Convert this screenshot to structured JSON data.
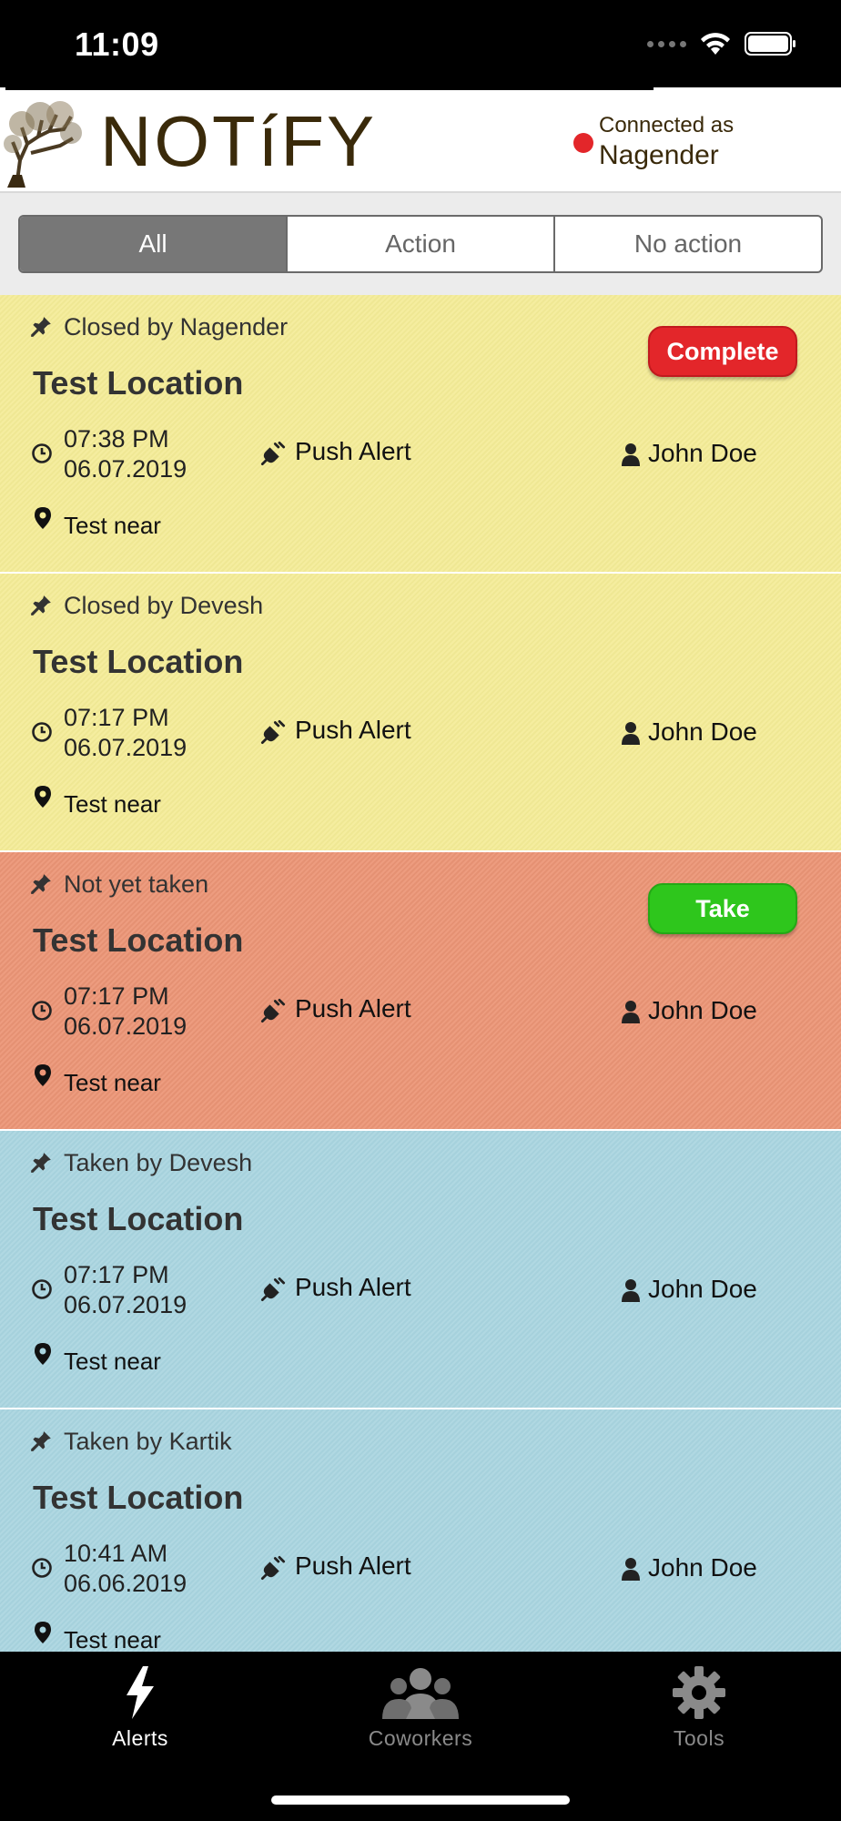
{
  "status_bar": {
    "time": "11:09"
  },
  "header": {
    "logo_text": "NOTíFY",
    "connected_label": "Connected as",
    "connected_user": "Nagender",
    "connection_status_color": "#e3262a"
  },
  "filter": {
    "tabs": [
      {
        "label": "All",
        "active": true
      },
      {
        "label": "Action",
        "active": false
      },
      {
        "label": "No action",
        "active": false
      }
    ]
  },
  "alerts": [
    {
      "status": "Closed by Nagender",
      "title": "Test Location",
      "time": "07:38 PM",
      "date": "06.07.2019",
      "type": "Push Alert",
      "assignee": "John Doe",
      "near": "Test near",
      "color": "yellow",
      "action": "Complete"
    },
    {
      "status": "Closed by Devesh",
      "title": "Test Location",
      "time": "07:17 PM",
      "date": "06.07.2019",
      "type": "Push Alert",
      "assignee": "John Doe",
      "near": "Test near",
      "color": "yellow",
      "action": ""
    },
    {
      "status": "Not yet taken",
      "title": "Test Location",
      "time": "07:17 PM",
      "date": "06.07.2019",
      "type": "Push Alert",
      "assignee": "John Doe",
      "near": "Test near",
      "color": "orange",
      "action": "Take"
    },
    {
      "status": "Taken by Devesh",
      "title": "Test Location",
      "time": "07:17 PM",
      "date": "06.07.2019",
      "type": "Push Alert",
      "assignee": "John Doe",
      "near": "Test near",
      "color": "blue",
      "action": ""
    },
    {
      "status": "Taken by Kartik",
      "title": "Test Location",
      "time": "10:41 AM",
      "date": "06.06.2019",
      "type": "Push Alert",
      "assignee": "John Doe",
      "near": "Test near",
      "color": "blue",
      "action": ""
    }
  ],
  "tab_bar": {
    "items": [
      {
        "label": "Alerts",
        "icon": "lightning-icon",
        "active": true
      },
      {
        "label": "Coworkers",
        "icon": "people-icon",
        "active": false
      },
      {
        "label": "Tools",
        "icon": "gear-icon",
        "active": false
      }
    ]
  }
}
